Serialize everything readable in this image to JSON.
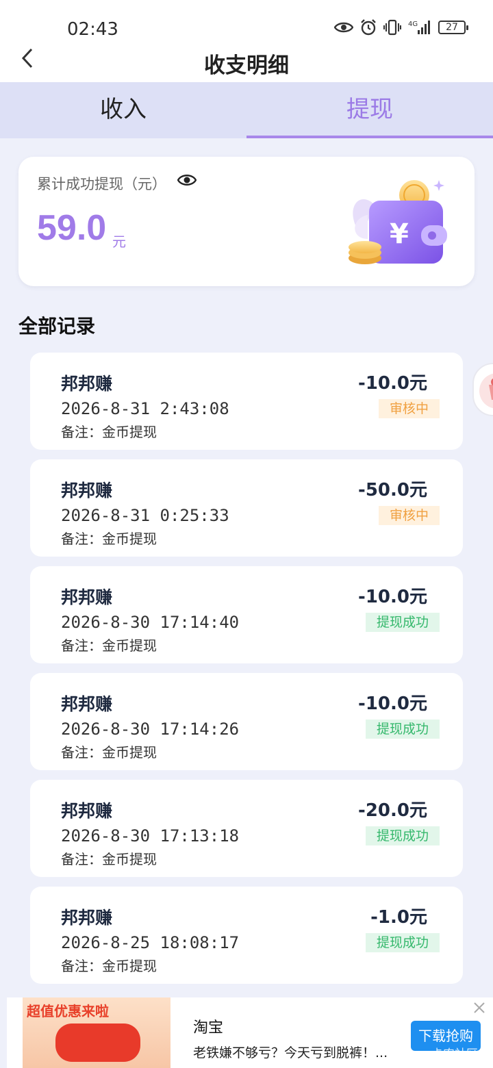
{
  "status_bar": {
    "time": "02:43",
    "network": "4G",
    "battery": "27",
    "icons": [
      "eye-icon",
      "alarm-icon",
      "vibrate-icon",
      "signal-icon",
      "battery-icon"
    ]
  },
  "header": {
    "title": "收支明细",
    "back_icon": "chevron-left-icon"
  },
  "tabs": [
    {
      "label": "收入",
      "active": false
    },
    {
      "label": "提现",
      "active": true
    }
  ],
  "summary": {
    "label": "累计成功提现（元）",
    "amount": "59.0",
    "unit": "元",
    "colors": {
      "accent": "#a07be8"
    }
  },
  "section_title": "全部记录",
  "records": [
    {
      "name": "邦邦赚",
      "date": "2026-8-31 2:43:08",
      "note": "备注：金币提现",
      "amount": "-10.0元",
      "status": "审核中",
      "status_type": "review"
    },
    {
      "name": "邦邦赚",
      "date": "2026-8-31 0:25:33",
      "note": "备注：金币提现",
      "amount": "-50.0元",
      "status": "审核中",
      "status_type": "review"
    },
    {
      "name": "邦邦赚",
      "date": "2026-8-30 17:14:40",
      "note": "备注：金币提现",
      "amount": "-10.0元",
      "status": "提现成功",
      "status_type": "success"
    },
    {
      "name": "邦邦赚",
      "date": "2026-8-30 17:14:26",
      "note": "备注：金币提现",
      "amount": "-10.0元",
      "status": "提现成功",
      "status_type": "success"
    },
    {
      "name": "邦邦赚",
      "date": "2026-8-30 17:13:18",
      "note": "备注：金币提现",
      "amount": "-20.0元",
      "status": "提现成功",
      "status_type": "success"
    },
    {
      "name": "邦邦赚",
      "date": "2026-8-25 18:08:17",
      "note": "备注：金币提现",
      "amount": "-1.0元",
      "status": "提现成功",
      "status_type": "success"
    }
  ],
  "ad": {
    "image_title": "超值优惠来啦",
    "brand": "淘宝",
    "description": "老铁嫌不够亏？今天亏到脱裤！...",
    "button": "下载抢购",
    "watermark": "卡农社区"
  }
}
